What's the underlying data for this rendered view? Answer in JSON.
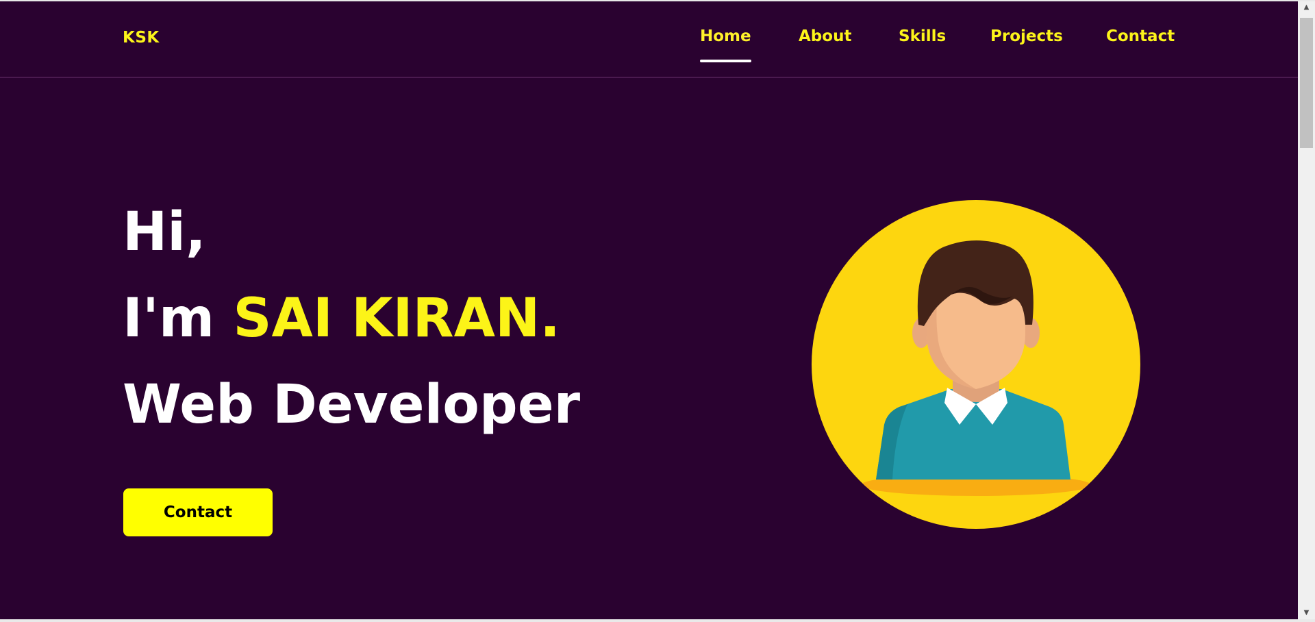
{
  "header": {
    "logo": "KSK",
    "nav": [
      {
        "label": "Home",
        "active": true
      },
      {
        "label": "About",
        "active": false
      },
      {
        "label": "Skills",
        "active": false
      },
      {
        "label": "Projects",
        "active": false
      },
      {
        "label": "Contact",
        "active": false
      }
    ]
  },
  "hero": {
    "greeting": "Hi,",
    "intro_prefix": "I'm",
    "name": "SAI KIRAN.",
    "role": "Web Developer",
    "cta_label": "Contact",
    "avatar_icon": "avatar-illustration"
  },
  "colors": {
    "background": "#2a0230",
    "accent": "#fcf41a",
    "button": "#ffff00",
    "avatar_circle": "#fdd60f",
    "sweater": "#219aaa"
  }
}
